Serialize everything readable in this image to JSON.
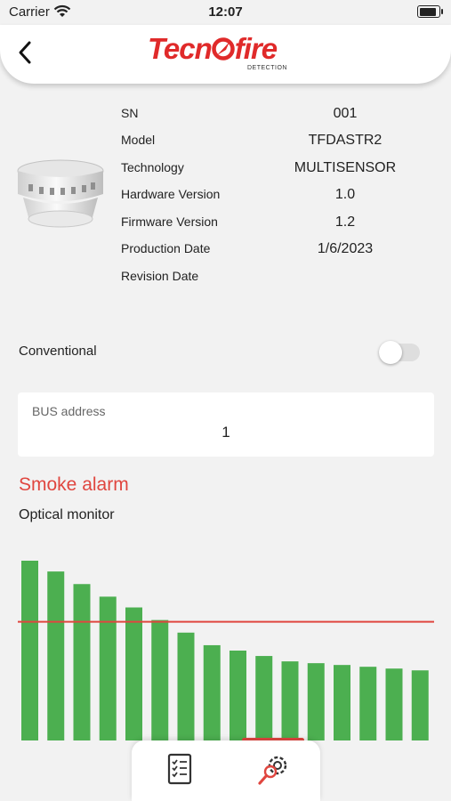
{
  "status_bar": {
    "carrier": "Carrier",
    "time": "12:07"
  },
  "header": {
    "logo_main_1": "Tecn",
    "logo_main_2": "fire",
    "logo_sub": "DETECTION"
  },
  "device_info": {
    "labels": [
      "SN",
      "Model",
      "Technology",
      "Hardware Version",
      "Firmware Version",
      "Production Date",
      "Revision Date"
    ],
    "values": [
      "001",
      "TFDASTR2",
      "MULTISENSOR",
      "1.0",
      "1.2",
      "1/6/2023",
      ""
    ]
  },
  "conventional": {
    "label": "Conventional",
    "enabled": false
  },
  "bus": {
    "label": "BUS address",
    "value": "1"
  },
  "alarm": {
    "title": "Smoke alarm",
    "subtitle": "Optical monitor"
  },
  "chart_data": {
    "type": "bar",
    "series": [
      {
        "values": [
          100,
          94,
          87,
          80,
          74,
          67,
          60,
          53,
          50,
          47,
          44,
          43,
          42,
          41,
          40,
          39
        ]
      }
    ],
    "threshold": 66,
    "ylim": [
      0,
      100
    ],
    "bar_color": "#4caf50",
    "threshold_color": "#e0463f"
  },
  "tabs": [
    {
      "icon": "checklist-icon",
      "active": false
    },
    {
      "icon": "gear-search-icon",
      "active": true
    }
  ],
  "colors": {
    "accent": "#e0463f",
    "background": "#f2f2f2"
  }
}
